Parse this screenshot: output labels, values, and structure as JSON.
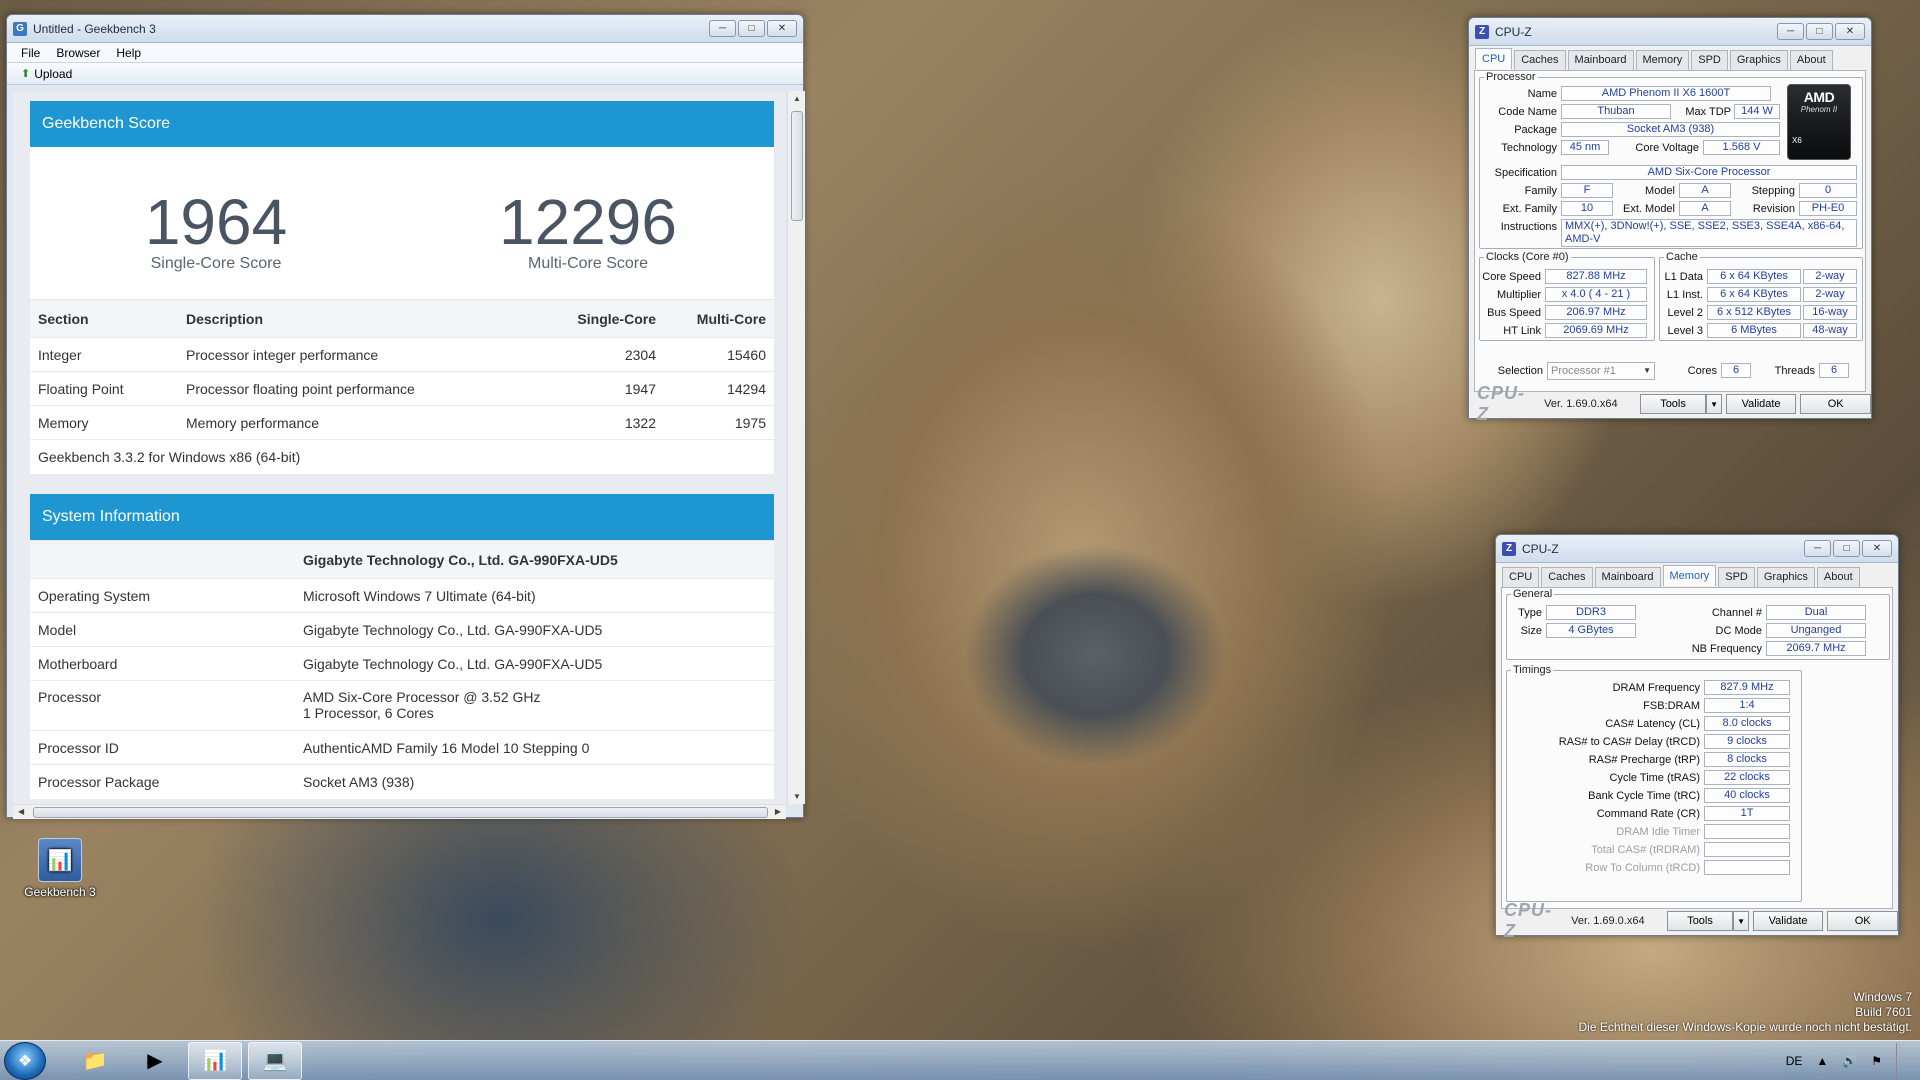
{
  "geekbench": {
    "title": "Untitled - Geekbench 3",
    "menu": [
      "File",
      "Browser",
      "Help"
    ],
    "upload_label": "Upload",
    "score_card": {
      "header": "Geekbench Score",
      "single_score": "1964",
      "single_label": "Single-Core Score",
      "multi_score": "12296",
      "multi_label": "Multi-Core Score",
      "columns": [
        "Section",
        "Description",
        "Single-Core",
        "Multi-Core"
      ],
      "rows": [
        [
          "Integer",
          "Processor integer performance",
          "2304",
          "15460"
        ],
        [
          "Floating Point",
          "Processor floating point performance",
          "1947",
          "14294"
        ],
        [
          "Memory",
          "Memory performance",
          "1322",
          "1975"
        ]
      ],
      "footer": "Geekbench 3.3.2 for Windows x86 (64-bit)"
    },
    "sysinfo": {
      "header": "System Information",
      "subtitle": "Gigabyte Technology Co., Ltd. GA-990FXA-UD5",
      "rows": [
        [
          "Operating System",
          "Microsoft Windows 7 Ultimate (64-bit)"
        ],
        [
          "Model",
          "Gigabyte Technology Co., Ltd. GA-990FXA-UD5"
        ],
        [
          "Motherboard",
          "Gigabyte Technology Co., Ltd. GA-990FXA-UD5"
        ],
        [
          "Processor",
          "AMD Six-Core Processor @ 3.52 GHz",
          "1 Processor, 6 Cores"
        ],
        [
          "Processor ID",
          "AuthenticAMD Family 16 Model 10 Stepping 0"
        ],
        [
          "Processor Package",
          "Socket AM3 (938)"
        ]
      ]
    }
  },
  "cpuz_common": {
    "title": "CPU-Z",
    "tabs": [
      "CPU",
      "Caches",
      "Mainboard",
      "Memory",
      "SPD",
      "Graphics",
      "About"
    ],
    "logo": "CPU-Z",
    "version": "Ver. 1.69.0.x64",
    "tools": "Tools",
    "validate": "Validate",
    "ok": "OK"
  },
  "cpuz_cpu": {
    "processor_legend": "Processor",
    "name_label": "Name",
    "name": "AMD Phenom II X6 1600T",
    "codename_label": "Code Name",
    "codename": "Thuban",
    "maxtdp_label": "Max TDP",
    "maxtdp": "144 W",
    "package_label": "Package",
    "package": "Socket AM3 (938)",
    "technology_label": "Technology",
    "technology": "45 nm",
    "voltage_label": "Core Voltage",
    "voltage": "1.568 V",
    "spec_label": "Specification",
    "spec": "AMD Six-Core Processor",
    "family_label": "Family",
    "family": "F",
    "model_label": "Model",
    "model": "A",
    "stepping_label": "Stepping",
    "stepping": "0",
    "extfamily_label": "Ext. Family",
    "extfamily": "10",
    "extmodel_label": "Ext. Model",
    "extmodel": "A",
    "revision_label": "Revision",
    "revision": "PH-E0",
    "instr_label": "Instructions",
    "instr": "MMX(+), 3DNow!(+), SSE, SSE2, SSE3, SSE4A, x86-64, AMD-V",
    "amd_logo_1": "AMD",
    "amd_logo_2": "Phenom II",
    "amd_logo_3": "X6",
    "clocks_legend": "Clocks (Core #0)",
    "corespeed_label": "Core Speed",
    "corespeed": "827.88 MHz",
    "multiplier_label": "Multiplier",
    "multiplier": "x 4.0 ( 4 - 21 )",
    "busspeed_label": "Bus Speed",
    "busspeed": "206.97 MHz",
    "htlink_label": "HT Link",
    "htlink": "2069.69 MHz",
    "cache_legend": "Cache",
    "l1d_label": "L1 Data",
    "l1d": "6 x 64 KBytes",
    "l1d_way": "2-way",
    "l1i_label": "L1 Inst.",
    "l1i": "6 x 64 KBytes",
    "l1i_way": "2-way",
    "l2_label": "Level 2",
    "l2": "6 x 512 KBytes",
    "l2_way": "16-way",
    "l3_label": "Level 3",
    "l3": "6 MBytes",
    "l3_way": "48-way",
    "selection_label": "Selection",
    "selection": "Processor #1",
    "cores_label": "Cores",
    "cores": "6",
    "threads_label": "Threads",
    "threads": "6"
  },
  "cpuz_mem": {
    "general_legend": "General",
    "type_label": "Type",
    "type": "DDR3",
    "size_label": "Size",
    "size": "4 GBytes",
    "channel_label": "Channel #",
    "channel": "Dual",
    "dcmode_label": "DC Mode",
    "dcmode": "Unganged",
    "nbfreq_label": "NB Frequency",
    "nbfreq": "2069.7 MHz",
    "timings_legend": "Timings",
    "timings": [
      [
        "DRAM Frequency",
        "827.9 MHz"
      ],
      [
        "FSB:DRAM",
        "1:4"
      ],
      [
        "CAS# Latency (CL)",
        "8.0 clocks"
      ],
      [
        "RAS# to CAS# Delay (tRCD)",
        "9 clocks"
      ],
      [
        "RAS# Precharge (tRP)",
        "8 clocks"
      ],
      [
        "Cycle Time (tRAS)",
        "22 clocks"
      ],
      [
        "Bank Cycle Time (tRC)",
        "40 clocks"
      ],
      [
        "Command Rate (CR)",
        "1T"
      ],
      [
        "DRAM Idle Timer",
        ""
      ],
      [
        "Total CAS# (tRDRAM)",
        ""
      ],
      [
        "Row To Column (tRCD)",
        ""
      ]
    ]
  },
  "desktop": {
    "icon_label": "Geekbench 3",
    "watermark_1": "Windows 7",
    "watermark_2": "Build 7601",
    "watermark_3": "Die Echtheit dieser Windows-Kopie wurde noch nicht bestätigt."
  },
  "taskbar": {
    "lang": "DE"
  }
}
